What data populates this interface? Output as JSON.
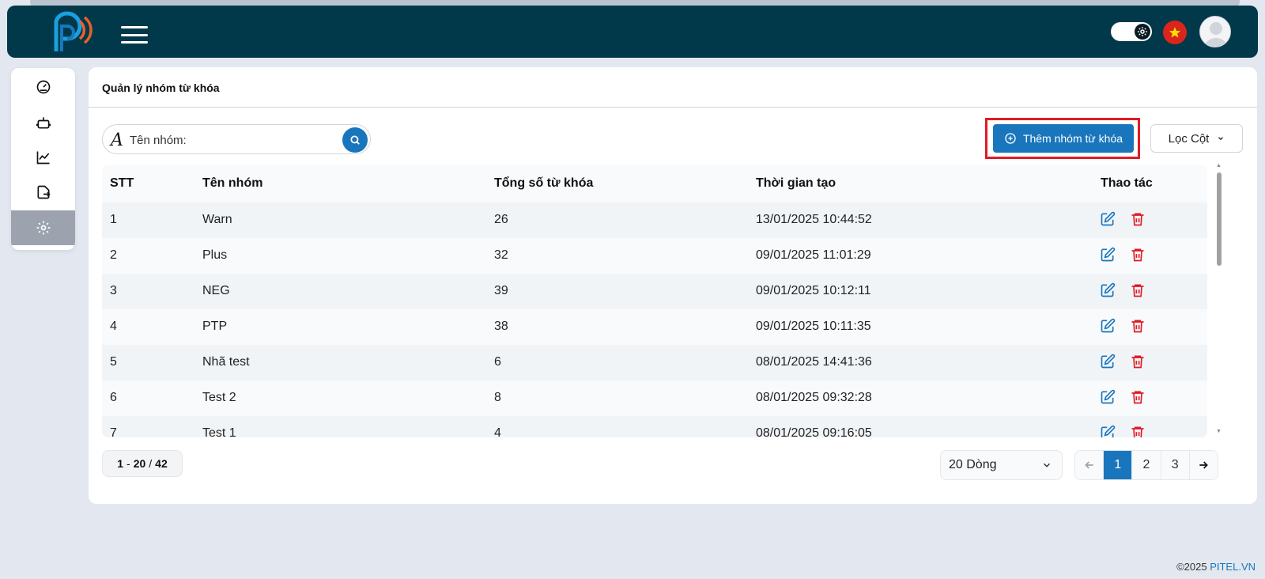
{
  "header": {
    "menu_icon": "hamburger-icon",
    "theme_icon": "gear-icon",
    "language_icon": "vietnam-flag-icon",
    "avatar_icon": "user-avatar-icon"
  },
  "sidebar": {
    "items": [
      {
        "icon": "dashboard-gauge-icon"
      },
      {
        "icon": "bot-icon"
      },
      {
        "icon": "chart-line-icon"
      },
      {
        "icon": "file-export-icon"
      },
      {
        "icon": "settings-gear-icon",
        "active": true
      }
    ]
  },
  "page": {
    "title": "Quản lý nhóm từ khóa"
  },
  "toolbar": {
    "search_placeholder": "Tên nhóm:",
    "search_value": "",
    "add_label": "Thêm nhóm từ khóa",
    "filter_label": "Lọc Cột"
  },
  "table": {
    "headers": [
      "STT",
      "Tên nhóm",
      "Tổng số từ khóa",
      "Thời gian tạo",
      "Thao tác"
    ],
    "rows": [
      {
        "stt": "1",
        "name": "Warn",
        "count": "26",
        "created": "13/01/2025 10:44:52"
      },
      {
        "stt": "2",
        "name": "Plus",
        "count": "32",
        "created": "09/01/2025 11:01:29"
      },
      {
        "stt": "3",
        "name": "NEG",
        "count": "39",
        "created": "09/01/2025 10:12:11"
      },
      {
        "stt": "4",
        "name": "PTP",
        "count": "38",
        "created": "09/01/2025 10:11:35"
      },
      {
        "stt": "5",
        "name": "Nhã test",
        "count": "6",
        "created": "08/01/2025 14:41:36"
      },
      {
        "stt": "6",
        "name": "Test 2",
        "count": "8",
        "created": "08/01/2025 09:32:28"
      },
      {
        "stt": "7",
        "name": "Test 1",
        "count": "4",
        "created": "08/01/2025 09:16:05"
      }
    ]
  },
  "pagination": {
    "range_start": "1",
    "range_end": "20",
    "total": "42",
    "rows_per_page": "20 Dòng",
    "pages": [
      "1",
      "2",
      "3"
    ],
    "current_page": "1"
  },
  "footer": {
    "copyright": "©2025 ",
    "brand": "PITEL.VN"
  },
  "colors": {
    "header_bg": "#02394a",
    "primary": "#1976bd",
    "danger": "#e01b24"
  }
}
